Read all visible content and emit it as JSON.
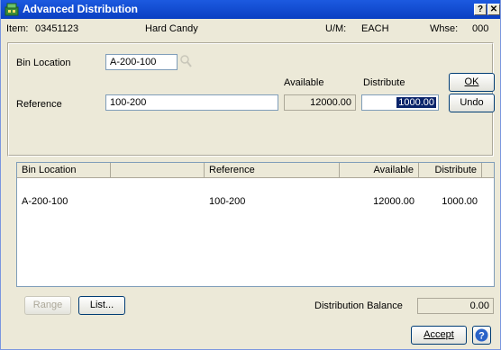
{
  "window": {
    "title": "Advanced Distribution"
  },
  "titlebar_buttons": {
    "help": "?",
    "close": "✕"
  },
  "header": {
    "item_label": "Item:",
    "item_value": "03451123",
    "description": "Hard Candy",
    "um_label": "U/M:",
    "um_value": "EACH",
    "whse_label": "Whse:",
    "whse_value": "000"
  },
  "form": {
    "bin_location_label": "Bin Location",
    "bin_location_value": "A-200-100",
    "available_label": "Available",
    "distribute_label": "Distribute",
    "reference_label": "Reference",
    "reference_value": "100-200",
    "available_value": "12000.00",
    "distribute_value": "1000.00"
  },
  "buttons": {
    "ok": "OK",
    "undo": "Undo",
    "range": "Range",
    "list": "List...",
    "accept": "Accept"
  },
  "grid": {
    "headers": [
      "Bin Location",
      "Reference",
      "Available",
      "Distribute"
    ],
    "rows": [
      [
        "A-200-100",
        "100-200",
        "12000.00",
        "1000.00"
      ]
    ]
  },
  "footer": {
    "distribution_balance_label": "Distribution Balance",
    "distribution_balance_value": "0.00"
  },
  "icons": {
    "title": "app-window-icon",
    "lookup": "magnifier-icon",
    "help": "question-icon"
  }
}
